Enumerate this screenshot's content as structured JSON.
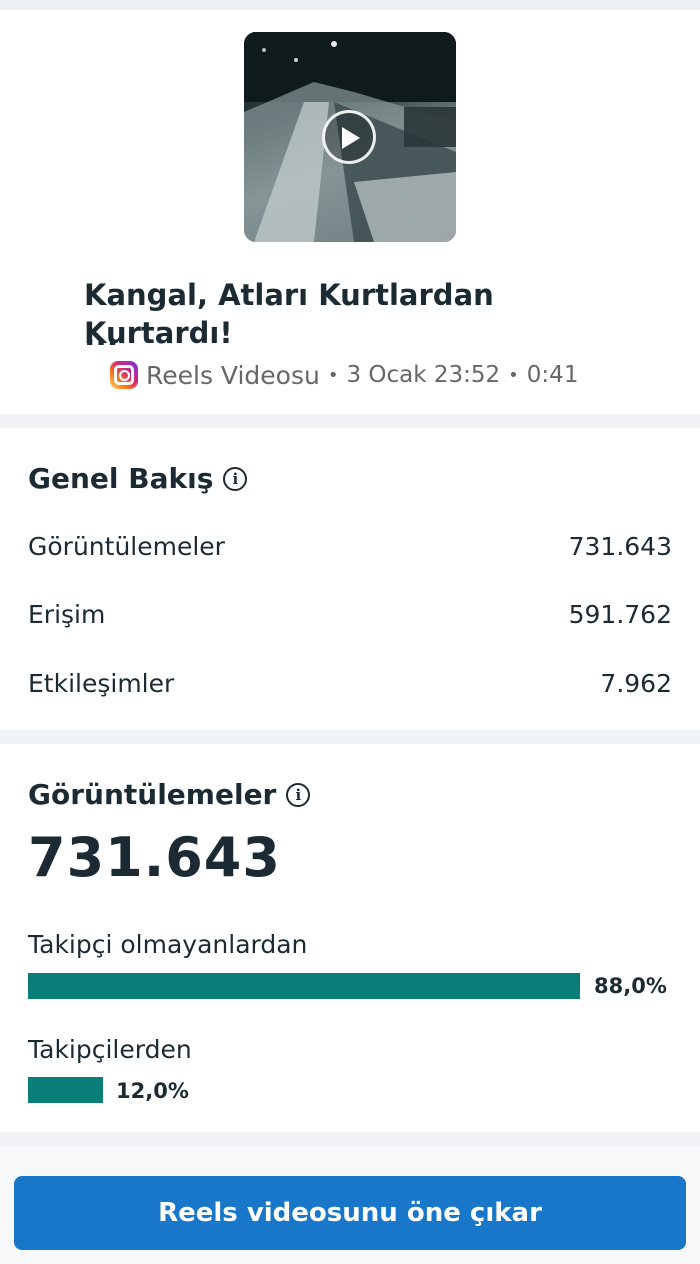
{
  "video": {
    "title": "Kangal, Atları Kurtlardan Kurtardı!",
    "ellipsis": "...",
    "type": "Reels Videosu",
    "separator": "•",
    "date": "3 Ocak 23:52",
    "duration": "0:41",
    "icons": {
      "platform": "instagram-icon",
      "play": "play-icon"
    }
  },
  "overview": {
    "title": "Genel Bakış",
    "info_glyph": "i",
    "rows": [
      {
        "label": "Görüntülemeler",
        "value": "731.643"
      },
      {
        "label": "Erişim",
        "value": "591.762"
      },
      {
        "label": "Etkileşimler",
        "value": "7.962"
      }
    ]
  },
  "views": {
    "title": "Görüntülemeler",
    "info_glyph": "i",
    "total": "731.643",
    "breakdown": [
      {
        "label": "Takipçi olmayanlardan",
        "percent_text": "88,0%",
        "percent": 88.0
      },
      {
        "label": "Takipçilerden",
        "percent_text": "12,0%",
        "percent": 12.0
      }
    ],
    "bar_color": "#0a7f7a"
  },
  "actions": {
    "promote_label": "Reels videosunu öne çıkar",
    "button_color": "#1877c9"
  }
}
